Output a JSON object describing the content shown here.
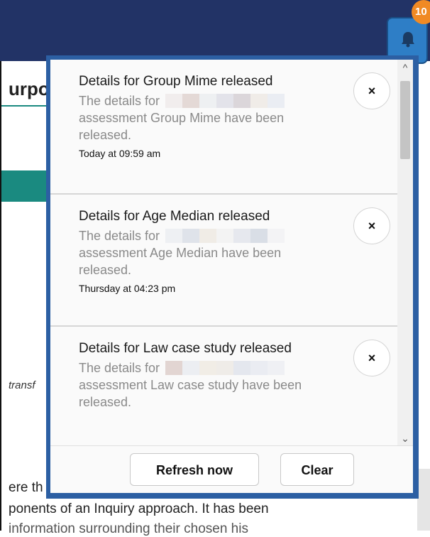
{
  "header": {
    "notification_count": "10",
    "bell_icon": "bell-icon"
  },
  "page": {
    "title_fragment": "urpo",
    "italic_fragment": "transf",
    "paragraph_fragments": [
      "ere th",
      "ponents of an Inquiry approach. It has been",
      "information surrounding their chosen his"
    ]
  },
  "notifications": [
    {
      "title": "Details for Group Mime released",
      "body_lead": "The details for",
      "body_rest": "assessment Group Mime have been released.",
      "time": "Today at 09:59 am",
      "close_label": "×"
    },
    {
      "title": "Details for Age Median released",
      "body_lead": "The details for",
      "body_rest": "assessment Age Median have been released.",
      "time": "Thursday at 04:23 pm",
      "close_label": "×"
    },
    {
      "title": "Details for Law case study released",
      "body_lead": "The details for",
      "body_rest": "assessment Law case study have been released.",
      "time": "",
      "close_label": "×"
    }
  ],
  "footer": {
    "refresh_label": "Refresh now",
    "clear_label": "Clear"
  },
  "colors": {
    "topbar": "#223366",
    "panel_border": "#2c5fa3",
    "badge": "#f08a24",
    "accent": "#1a8a80"
  }
}
